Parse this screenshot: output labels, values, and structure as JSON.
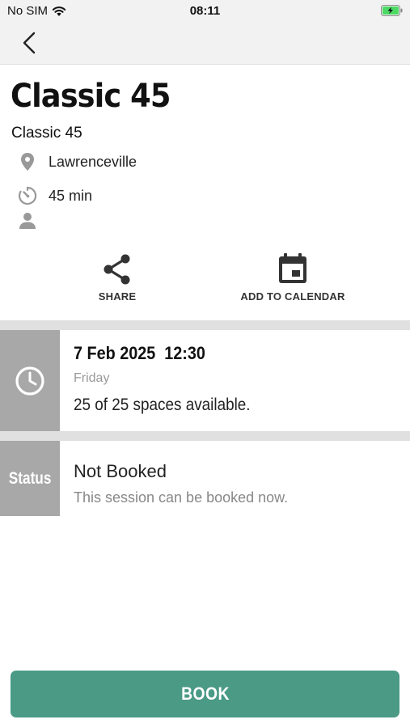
{
  "status_bar": {
    "carrier": "No SIM",
    "time": "08:11"
  },
  "class": {
    "title": "Classic 45",
    "subtitle": "Classic 45",
    "location": "Lawrenceville",
    "duration": "45 min",
    "instructor": ""
  },
  "actions": {
    "share": "SHARE",
    "add_to_calendar": "ADD TO CALENDAR"
  },
  "session": {
    "date_time": "7 Feb 2025  12:30",
    "day": "Friday",
    "spaces": "25 of 25 spaces available."
  },
  "status": {
    "side_label": "Status",
    "title": "Not Booked",
    "description": "This session can be booked now."
  },
  "book_button": "BOOK",
  "colors": {
    "accent": "#4a9a86",
    "side_block": "#a8a8a8",
    "battery": "#4cd964"
  },
  "icons": [
    "wifi-icon",
    "battery-charging-icon",
    "back-chevron-icon",
    "location-pin-icon",
    "timer-icon",
    "person-icon",
    "share-icon",
    "calendar-icon",
    "clock-icon"
  ]
}
